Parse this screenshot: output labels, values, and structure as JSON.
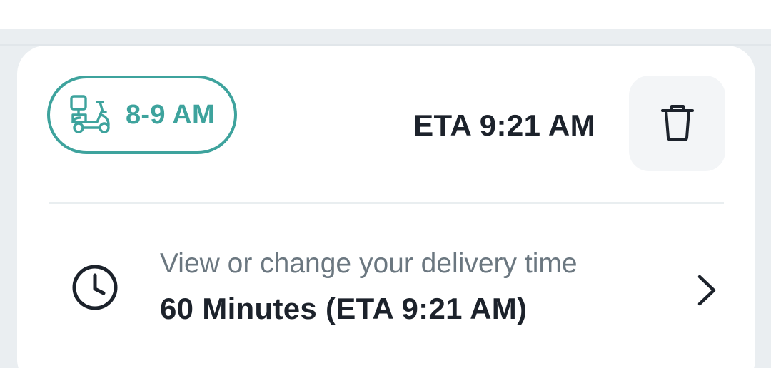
{
  "colors": {
    "accent": "#3ea39d",
    "text_primary": "#1c222b",
    "text_secondary": "#6b7780",
    "button_bg": "#f3f5f7",
    "page_bg": "#eaeef1"
  },
  "order": {
    "slot_icon": "scooter-delivery-icon",
    "slot_label": "8-9 AM",
    "eta_label": "ETA 9:21 AM",
    "delete_icon": "trash-icon"
  },
  "delivery": {
    "icon": "clock-icon",
    "caption": "View or change your delivery time",
    "value": "60 Minutes (ETA 9:21 AM)",
    "chevron_icon": "chevron-right-icon"
  }
}
